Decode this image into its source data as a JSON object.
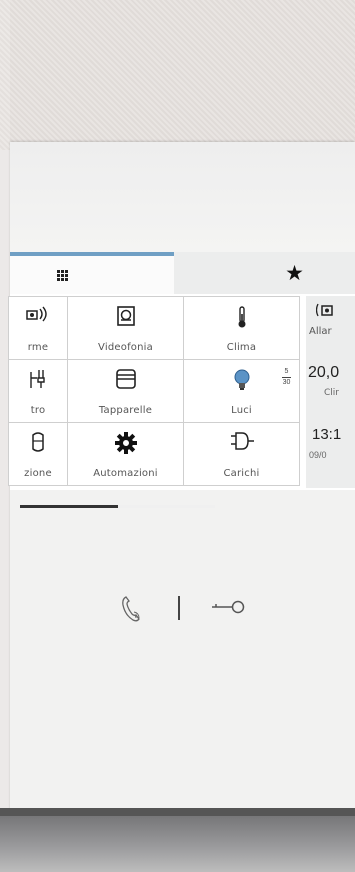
{
  "tabs": {
    "grid_icon": "grid-icon",
    "favorites_icon": "star-icon"
  },
  "tiles": [
    {
      "label": "rme",
      "icon": "alarm-icon"
    },
    {
      "label": "Videofonia",
      "icon": "videophone-icon"
    },
    {
      "label": "Clima",
      "icon": "thermometer-icon"
    },
    {
      "label": "tro",
      "icon": "plug-sensor-icon"
    },
    {
      "label": "Tapparelle",
      "icon": "shutter-icon"
    },
    {
      "label": "Luci",
      "icon": "bulb-icon",
      "badge_top": "5",
      "badge_bottom": "30"
    },
    {
      "label": "zione",
      "icon": "motion-icon"
    },
    {
      "label": "Automazioni",
      "icon": "gear-icon"
    },
    {
      "label": "Carichi",
      "icon": "power-plug-icon"
    }
  ],
  "right_panel": {
    "alarm_label": "Allar",
    "temperature": "20,0",
    "climate_label": "Clir",
    "time": "13:1",
    "date": "09/0"
  },
  "scroll": {
    "position": 0.5
  },
  "device_controls": {
    "handset_icon": "handset-icon",
    "key_icon": "key-icon"
  },
  "colors": {
    "accent": "#6f9fc4",
    "tile_border": "#cfcfcf",
    "panel_bg": "#eceded"
  }
}
